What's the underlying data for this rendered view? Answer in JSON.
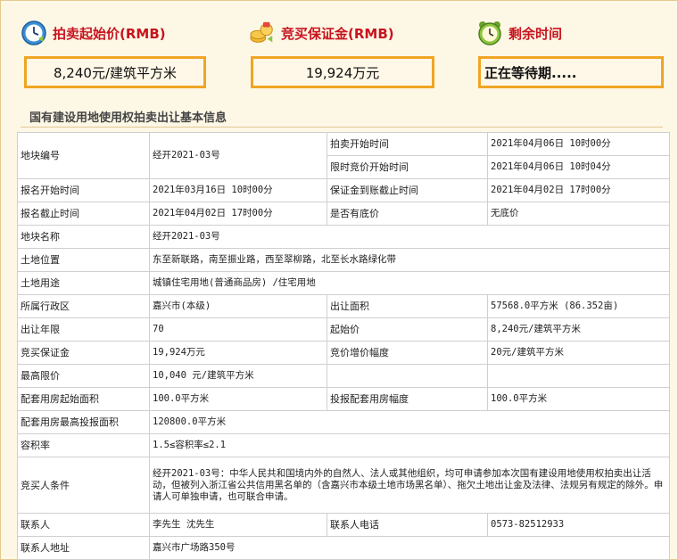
{
  "header": {
    "start_price_label": "拍卖起始价(RMB)",
    "start_price_value": "8,240元/建筑平方米",
    "deposit_label": "竞买保证金(RMB)",
    "deposit_value": "19,924万元",
    "remaining_label": "剩余时间",
    "remaining_value": "正在等待期.....",
    "icons": [
      "clock-icon",
      "coins-icon",
      "alarm-clock-icon"
    ],
    "accent_color": "#f0a524",
    "label_color": "#c8141e"
  },
  "section_title": "国有建设用地使用权拍卖出让基本信息",
  "rows": {
    "r1": {
      "k1": "地块编号",
      "v1": "经开2021-03号",
      "k2a": "拍卖开始时间",
      "v2a": "2021年04月06日 10时00分",
      "k2b": "限时竞价开始时间",
      "v2b": "2021年04月06日 10时04分"
    },
    "r2": {
      "k1": "报名开始时间",
      "v1": "2021年03月16日 10时00分",
      "k2": "保证金到账截止时间",
      "v2": "2021年04月02日 17时00分"
    },
    "r3": {
      "k1": "报名截止时间",
      "v1": "2021年04月02日 17时00分",
      "k2": "是否有底价",
      "v2": "无底价"
    },
    "r4": {
      "k1": "地块名称",
      "v1": "经开2021-03号"
    },
    "r5": {
      "k1": "土地位置",
      "v1": "东至新联路，南至振业路，西至翠柳路，北至长水路绿化带"
    },
    "r6": {
      "k1": "土地用途",
      "v1": "城镇住宅用地(普通商品房) /住宅用地"
    },
    "r7": {
      "k1": "所属行政区",
      "v1": "嘉兴市(本级)",
      "k2": "出让面积",
      "v2": "57568.0平方米 (86.352亩)"
    },
    "r8": {
      "k1": "出让年限",
      "v1": "70",
      "k2": "起始价",
      "v2": "8,240元/建筑平方米"
    },
    "r9": {
      "k1": "竞买保证金",
      "v1": "19,924万元",
      "k2": "竞价增价幅度",
      "v2": "20元/建筑平方米"
    },
    "r10": {
      "k1": "最高限价",
      "v1": "10,040 元/建筑平方米",
      "k2": "",
      "v2": ""
    },
    "r11": {
      "k1": "配套用房起始面积",
      "v1": "100.0平方米",
      "k2": "投报配套用房幅度",
      "v2": "100.0平方米"
    },
    "r12": {
      "k1": "配套用房最高投报面积",
      "v1": "120800.0平方米"
    },
    "r13": {
      "k1": "容积率",
      "v1": "1.5≤容积率≤2.1"
    },
    "r14": {
      "k1": "竞买人条件",
      "v1": "经开2021-03号：中华人民共和国境内外的自然人、法人或其他组织，均可申请参加本次国有建设用地使用权拍卖出让活动，但被列入浙江省公共信用黑名单的（含嘉兴市本级土地市场黑名单）、拖欠土地出让金及法律、法规另有规定的除外。申请人可单独申请，也可联合申请。"
    },
    "r15": {
      "k1": "联系人",
      "v1": "李先生 沈先生",
      "k2": "联系人电话",
      "v2": "0573-82512933"
    },
    "r16": {
      "k1": "联系人地址",
      "v1": "嘉兴市广场路350号"
    }
  }
}
